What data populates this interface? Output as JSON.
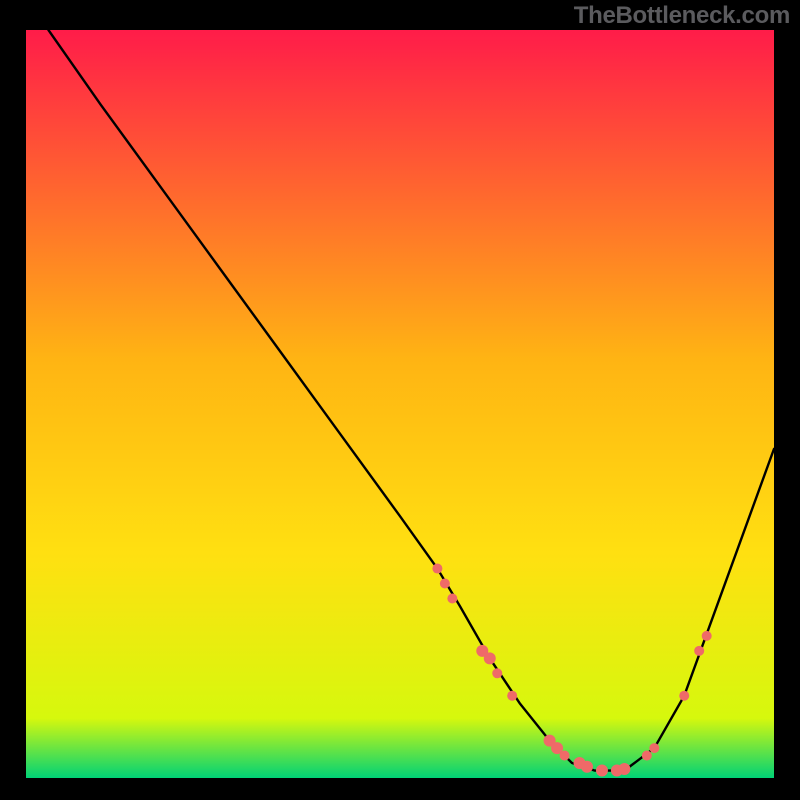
{
  "watermark": "TheBottleneck.com",
  "chart_data": {
    "type": "line",
    "title": "",
    "xlabel": "",
    "ylabel": "",
    "xlim": [
      0,
      100
    ],
    "ylim": [
      0,
      100
    ],
    "grid": false,
    "legend_position": "none",
    "background_gradient": {
      "top": "#ff1c49",
      "mid": "#ffe011",
      "bottom": "#00d276"
    },
    "series": [
      {
        "name": "curve",
        "color": "#000000",
        "x": [
          3,
          10,
          18,
          26,
          34,
          42,
          50,
          55,
          58,
          62,
          66,
          70,
          73,
          76,
          80,
          84,
          88,
          92,
          96,
          100
        ],
        "y": [
          100,
          90,
          79,
          68,
          57,
          46,
          35,
          28,
          23,
          16,
          10,
          5,
          2,
          1,
          1,
          4,
          11,
          22,
          33,
          44
        ]
      },
      {
        "name": "markers",
        "color": "#ef6a68",
        "type": "scatter",
        "points": [
          {
            "x": 55,
            "y": 28,
            "r": 5
          },
          {
            "x": 56,
            "y": 26,
            "r": 5
          },
          {
            "x": 57,
            "y": 24,
            "r": 5
          },
          {
            "x": 61,
            "y": 17,
            "r": 6
          },
          {
            "x": 62,
            "y": 16,
            "r": 6
          },
          {
            "x": 63,
            "y": 14,
            "r": 5
          },
          {
            "x": 65,
            "y": 11,
            "r": 5
          },
          {
            "x": 70,
            "y": 5,
            "r": 6
          },
          {
            "x": 71,
            "y": 4,
            "r": 6
          },
          {
            "x": 72,
            "y": 3,
            "r": 5
          },
          {
            "x": 74,
            "y": 2,
            "r": 6
          },
          {
            "x": 75,
            "y": 1.5,
            "r": 6
          },
          {
            "x": 77,
            "y": 1,
            "r": 6
          },
          {
            "x": 79,
            "y": 1,
            "r": 6
          },
          {
            "x": 80,
            "y": 1.2,
            "r": 6
          },
          {
            "x": 83,
            "y": 3,
            "r": 5
          },
          {
            "x": 84,
            "y": 4,
            "r": 5
          },
          {
            "x": 88,
            "y": 11,
            "r": 5
          },
          {
            "x": 90,
            "y": 17,
            "r": 5
          },
          {
            "x": 91,
            "y": 19,
            "r": 5
          }
        ]
      }
    ]
  }
}
